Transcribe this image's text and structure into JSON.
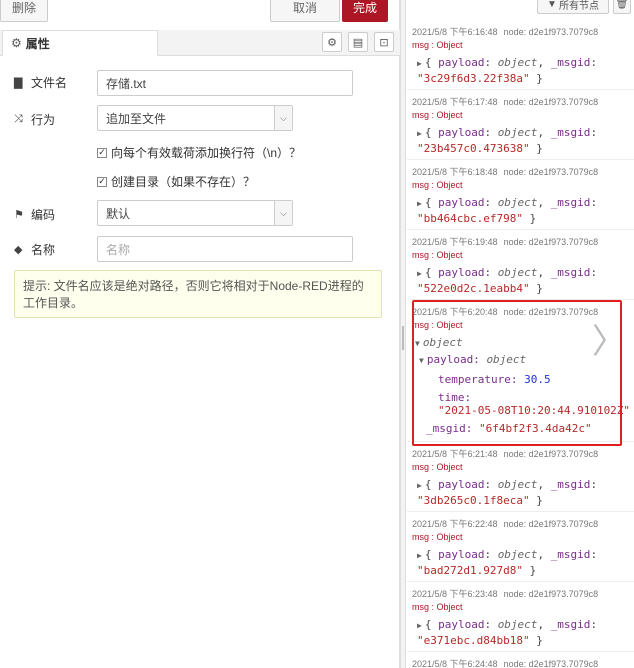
{
  "editor": {
    "delete_label": "删除",
    "cancel_label": "取消",
    "done_label": "完成",
    "tab_properties": "属性",
    "filename_label": "文件名",
    "filename_value": "存储.txt",
    "action_label": "行为",
    "action_value": "追加至文件",
    "checkbox_newline": "向每个有效载荷添加换行符（\\n）？",
    "checkbox_createdir": "创建目录（如果不存在）？",
    "encoding_label": "编码",
    "encoding_value": "默认",
    "name_label": "名称",
    "name_placeholder": "名称",
    "hint": "提示: 文件名应该是绝对路径，否则它将相对于Node-RED进程的工作目录。"
  },
  "debug": {
    "filter_label": "所有节点",
    "topic": "msg : Object",
    "node_label": "node: d2e1f973.7079c8",
    "messages": [
      {
        "time": "2021/5/8 下午6:16:48",
        "msgid": "\"3c29f6d3.22f38a\""
      },
      {
        "time": "2021/5/8 下午6:17:48",
        "msgid": "\"23b457c0.473638\""
      },
      {
        "time": "2021/5/8 下午6:18:48",
        "msgid": "\"bb464cbc.ef798\""
      },
      {
        "time": "2021/5/8 下午6:19:48",
        "msgid": "\"522e0d2c.1eabb4\""
      },
      {
        "time": "2021/5/8 下午6:20:48"
      },
      {
        "time": "2021/5/8 下午6:21:48",
        "msgid": "\"3db265c0.1f8eca\""
      },
      {
        "time": "2021/5/8 下午6:22:48",
        "msgid": "\"bad272d1.927d8\""
      },
      {
        "time": "2021/5/8 下午6:23:48",
        "msgid": "\"e371ebc.d84bb18\""
      },
      {
        "time": "2021/5/8 下午6:24:48"
      }
    ],
    "collapsed_prefix": "{ ",
    "payload_key": "payload",
    "object_type": "object",
    "msgid_key": "_msgid",
    "expanded": {
      "root_type": "object",
      "payload_key": "payload:",
      "payload_type": "object",
      "temperature_key": "temperature:",
      "temperature_value": "30.5",
      "time_key": "time:",
      "time_value": "\"2021-05-08T10:20:44.910102Z\"",
      "msgid_key": "_msgid:",
      "msgid_value": "\"6f4bf2f3.4da42c\""
    }
  },
  "colors": {
    "done_button": "#ad1625",
    "highlight": "#e02020",
    "key_purple": "#792e8a",
    "string_red": "#b72828",
    "number_blue": "#2033d6"
  }
}
